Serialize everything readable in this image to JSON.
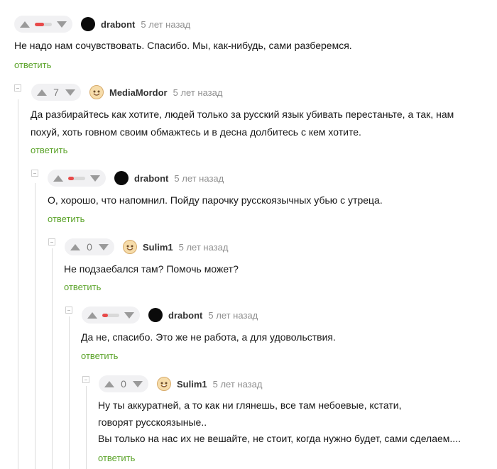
{
  "comments": [
    {
      "author": "drabont",
      "time": "5 лет назад",
      "rating": "",
      "rating_fraction": 0.55,
      "avatar": "black-circle-avatar",
      "lines": [
        "Не надо нам сочувствовать. Спасибо. Мы, как-нибудь, сами разберемся."
      ],
      "reply": "ответить"
    },
    {
      "author": "MediaMordor",
      "time": "5 лет назад",
      "rating": "7",
      "avatar": "cartoon-face-avatar",
      "lines": [
        "Да разбирайтесь как хотите, людей только за русский язык убивать перестаньте, а так, нам",
        "похуй, хоть говном своим обмажтесь и в десна долбитесь с кем хотите."
      ],
      "reply": "ответить"
    },
    {
      "author": "drabont",
      "time": "5 лет назад",
      "rating": "",
      "rating_fraction": 0.35,
      "avatar": "black-circle-avatar",
      "lines": [
        "О, хорошо, что напомнил. Пойду парочку русскоязычных убью с утреца."
      ],
      "reply": "ответить"
    },
    {
      "author": "Sulim1",
      "time": "5 лет назад",
      "rating": "0",
      "avatar": "cartoon-face-avatar",
      "lines": [
        "Не подзаебался там? Помочь может?"
      ],
      "reply": "ответить"
    },
    {
      "author": "drabont",
      "time": "5 лет назад",
      "rating": "",
      "rating_fraction": 0.35,
      "avatar": "black-circle-avatar",
      "lines": [
        "Да не, спасибо. Это же не работа, а для удовольствия."
      ],
      "reply": "ответить"
    },
    {
      "author": "Sulim1",
      "time": "5 лет назад",
      "rating": "0",
      "avatar": "cartoon-face-avatar",
      "lines": [
        "Ну ты аккуратней, а то как ни глянешь, все там небоевые, кстати,",
        "говорят русскоязыные..",
        "Вы только на нас их не вешайте, не стоит, когда нужно будет, сами сделаем...."
      ],
      "reply": "ответить"
    }
  ],
  "colors": {
    "reply": "#5ba32a",
    "downvote_bar": "#e84a4a",
    "rating_bg": "#f1f1f3"
  }
}
